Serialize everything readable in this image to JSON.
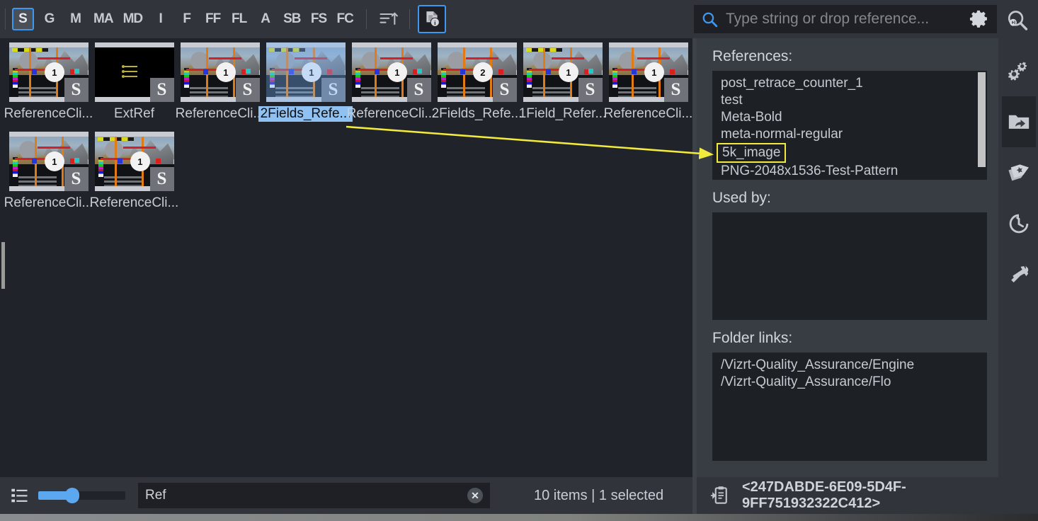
{
  "toolbar": {
    "filters": [
      {
        "label": "S",
        "name": "filter-scene",
        "active": true
      },
      {
        "label": "G",
        "name": "filter-geometry",
        "active": false
      },
      {
        "label": "M",
        "name": "filter-material",
        "active": false
      },
      {
        "label": "MA",
        "name": "filter-material-a",
        "active": false
      },
      {
        "label": "MD",
        "name": "filter-material-d",
        "active": false
      },
      {
        "label": "I",
        "name": "filter-image",
        "active": false
      },
      {
        "label": "F",
        "name": "filter-font",
        "active": false
      },
      {
        "label": "FF",
        "name": "filter-font-family",
        "active": false
      },
      {
        "label": "FL",
        "name": "filter-font-list",
        "active": false
      },
      {
        "label": "A",
        "name": "filter-audio",
        "active": false
      },
      {
        "label": "SB",
        "name": "filter-substance",
        "active": false
      },
      {
        "label": "FS",
        "name": "filter-fontstyle",
        "active": false
      },
      {
        "label": "FC",
        "name": "filter-fontcollection",
        "active": false
      }
    ],
    "sort_icon": "sort-ascending-icon",
    "info_icon": "document-info-icon",
    "info_active": true
  },
  "search": {
    "icon": "search-icon",
    "placeholder": "Type string or drop reference...",
    "value": "",
    "gear_icon": "gear-icon",
    "deep_search_icon": "deep-search-icon"
  },
  "grid": {
    "items": [
      {
        "label": "ReferenceCli...",
        "badge": "S",
        "selected": false,
        "kind": "pattern"
      },
      {
        "label": "ExtRef",
        "badge": "S",
        "selected": false,
        "kind": "extref"
      },
      {
        "label": "ReferenceCli...",
        "badge": "S",
        "selected": false,
        "kind": "pattern"
      },
      {
        "label": "2Fields_Refe...",
        "badge": "S",
        "selected": true,
        "kind": "pattern"
      },
      {
        "label": "ReferenceCli...",
        "badge": "S",
        "selected": false,
        "kind": "pattern"
      },
      {
        "label": "2Fields_Refe...",
        "badge": "S",
        "selected": false,
        "kind": "pattern"
      },
      {
        "label": "1Field_Refer...",
        "badge": "S",
        "selected": false,
        "kind": "pattern"
      },
      {
        "label": "ReferenceCli...",
        "badge": "S",
        "selected": false,
        "kind": "pattern"
      },
      {
        "label": "ReferenceCli...",
        "badge": "S",
        "selected": false,
        "kind": "pattern"
      },
      {
        "label": "ReferenceCli...",
        "badge": "S",
        "selected": false,
        "kind": "pattern"
      }
    ]
  },
  "statusbar": {
    "view_icon": "list-view-icon",
    "zoom_slider_value": "30",
    "filter_value": "Ref",
    "filter_placeholder": "",
    "clear_icon": "clear-icon",
    "count_text": "10 items | 1 selected"
  },
  "panel": {
    "references_label": "References:",
    "references": [
      {
        "text": "post_retrace_counter_1",
        "annotated": false
      },
      {
        "text": "test",
        "annotated": false
      },
      {
        "text": "Meta-Bold",
        "annotated": false
      },
      {
        "text": "meta-normal-regular",
        "annotated": false
      },
      {
        "text": "5k_image",
        "annotated": true
      },
      {
        "text": "PNG-2048x1536-Test-Pattern",
        "annotated": false
      }
    ],
    "used_by_label": "Used by:",
    "used_by": [],
    "folder_links_label": "Folder links:",
    "folder_links": [
      {
        "text": "/Vizrt-Quality_Assurance/Engine"
      },
      {
        "text": "/Vizrt-Quality_Assurance/Flo"
      }
    ],
    "uuid_icon": "paste-uuid-icon",
    "uuid": "<247DABDE-6E09-5D4F-9FF751932322C412>"
  },
  "rail": {
    "items": [
      {
        "name": "rail-settings-icon",
        "icon": "gears-icon",
        "active": false
      },
      {
        "name": "rail-folder-icon",
        "icon": "folder-share-icon",
        "active": true
      },
      {
        "name": "rail-tags-icon",
        "icon": "tags-star-icon",
        "active": false
      },
      {
        "name": "rail-history-icon",
        "icon": "clock-history-icon",
        "active": false
      },
      {
        "name": "rail-tools-icon",
        "icon": "tools-icon",
        "active": false
      }
    ]
  },
  "annotation": {
    "arrow_color": "#f2ea3c",
    "box_color": "#f2ea3c",
    "target_label": "5k_image",
    "source_label": "2Fields_Refe..."
  },
  "colors": {
    "accent_blue": "#3d98f0",
    "selection_blue": "#8fc2f2",
    "panel_bg": "#383c43",
    "content_bg": "#202329",
    "list_bg": "#1d2025",
    "toolbar_bg": "#31343a",
    "annotation_yellow": "#f2ea3c"
  }
}
